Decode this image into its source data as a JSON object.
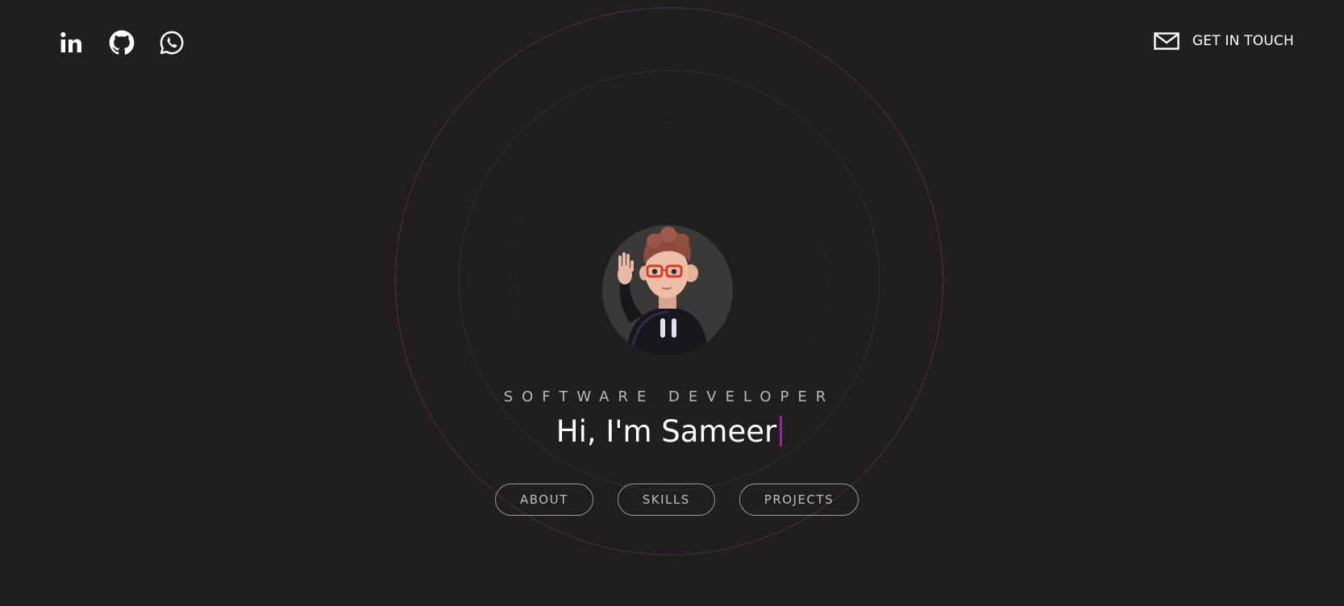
{
  "socials": [
    {
      "name": "linkedin-icon"
    },
    {
      "name": "github-icon"
    },
    {
      "name": "whatsapp-icon"
    }
  ],
  "contact": {
    "label": "GET IN TOUCH",
    "icon": "mail-icon"
  },
  "hero": {
    "role": "SOFTWARE DEVELOPER",
    "greeting": "Hi, I'm Sameer",
    "caret_color": "#a31f9f"
  },
  "nav": {
    "about": "ABOUT",
    "skills": "SKILLS",
    "projects": "PROJECTS"
  },
  "colors": {
    "background": "#201f1e",
    "accent": "#a31f9f",
    "text": "#ffffff",
    "muted": "#b9b9b9"
  }
}
